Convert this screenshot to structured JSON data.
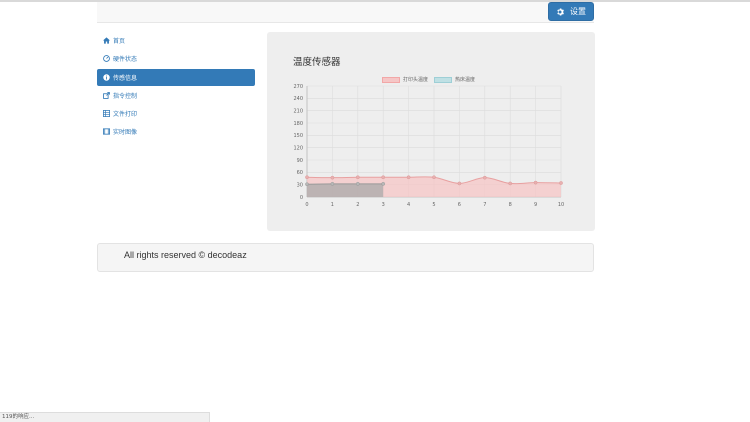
{
  "navbar": {
    "settings_label": "设置",
    "settings_icon": "gear-icon"
  },
  "sidebar": {
    "items": [
      {
        "label": "首页",
        "icon": "home-icon",
        "active": false
      },
      {
        "label": "硬件状态",
        "icon": "dashboard-icon",
        "active": false
      },
      {
        "label": "传感信息",
        "icon": "info-icon",
        "active": true
      },
      {
        "label": "指令控制",
        "icon": "share-icon",
        "active": false
      },
      {
        "label": "文件打印",
        "icon": "list-icon",
        "active": false
      },
      {
        "label": "实时图像",
        "icon": "film-icon",
        "active": false
      }
    ]
  },
  "panel": {
    "title": "温度传感器"
  },
  "chart_data": {
    "type": "line",
    "x": [
      0,
      1,
      2,
      3,
      4,
      5,
      6,
      7,
      8,
      9,
      10
    ],
    "x_tick_labels": [
      "0",
      "1",
      "2",
      "3",
      "4",
      "5",
      "6",
      "7",
      "8",
      "9",
      "10"
    ],
    "y_ticks": [
      0,
      30,
      60,
      90,
      120,
      150,
      180,
      210,
      240,
      270
    ],
    "ylim": [
      0,
      270
    ],
    "grid": true,
    "legend_position": "top",
    "series": [
      {
        "name": "打印头温度",
        "values": [
          48,
          47,
          48,
          48,
          48,
          48,
          33,
          47,
          33,
          35,
          34
        ],
        "color": "#f2a7a7",
        "fill": "#f5c6c6"
      },
      {
        "name": "热床温度",
        "values": [
          31,
          32,
          32,
          32
        ],
        "color": "#9ecfd6",
        "fill": "#a9a9a9"
      }
    ]
  },
  "footer": {
    "text": "All rights reserved © decodeaz"
  },
  "status": {
    "text": "119的响应..."
  }
}
